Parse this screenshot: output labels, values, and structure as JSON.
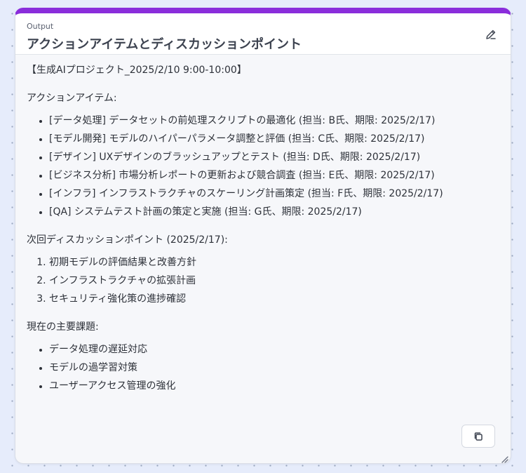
{
  "panel": {
    "overline": "Output",
    "title": "アクションアイテムとディスカッションポイント"
  },
  "content": {
    "heading": "【生成AIプロジェクト_2025/2/10 9:00-10:00】",
    "action_items_label": "アクションアイテム:",
    "action_items": [
      "[データ処理] データセットの前処理スクリプトの最適化 (担当: B氏、期限: 2025/2/17)",
      "[モデル開発] モデルのハイパーパラメータ調整と評価 (担当: C氏、期限: 2025/2/17)",
      "[デザイン] UXデザインのブラッシュアップとテスト (担当: D氏、期限: 2025/2/17)",
      "[ビジネス分析] 市場分析レポートの更新および競合調査 (担当: E氏、期限: 2025/2/17)",
      "[インフラ] インフラストラクチャのスケーリング計画策定 (担当: F氏、期限: 2025/2/17)",
      "[QA] システムテスト計画の策定と実施 (担当: G氏、期限: 2025/2/17)"
    ],
    "discussion_label": "次回ディスカッションポイント (2025/2/17):",
    "discussion_points": [
      "初期モデルの評価結果と改善方針",
      "インフラストラクチャの拡張計画",
      "セキュリティ強化策の進捗確認"
    ],
    "issues_label": "現在の主要課題:",
    "issues": [
      "データ処理の遅延対応",
      "モデルの過学習対策",
      "ユーザーアクセス管理の強化"
    ]
  },
  "icons": {
    "edit": "pencil-icon",
    "copy": "copy-icon",
    "resize": "resize-handle-icon"
  },
  "colors": {
    "accent": "#8a2ddb"
  }
}
